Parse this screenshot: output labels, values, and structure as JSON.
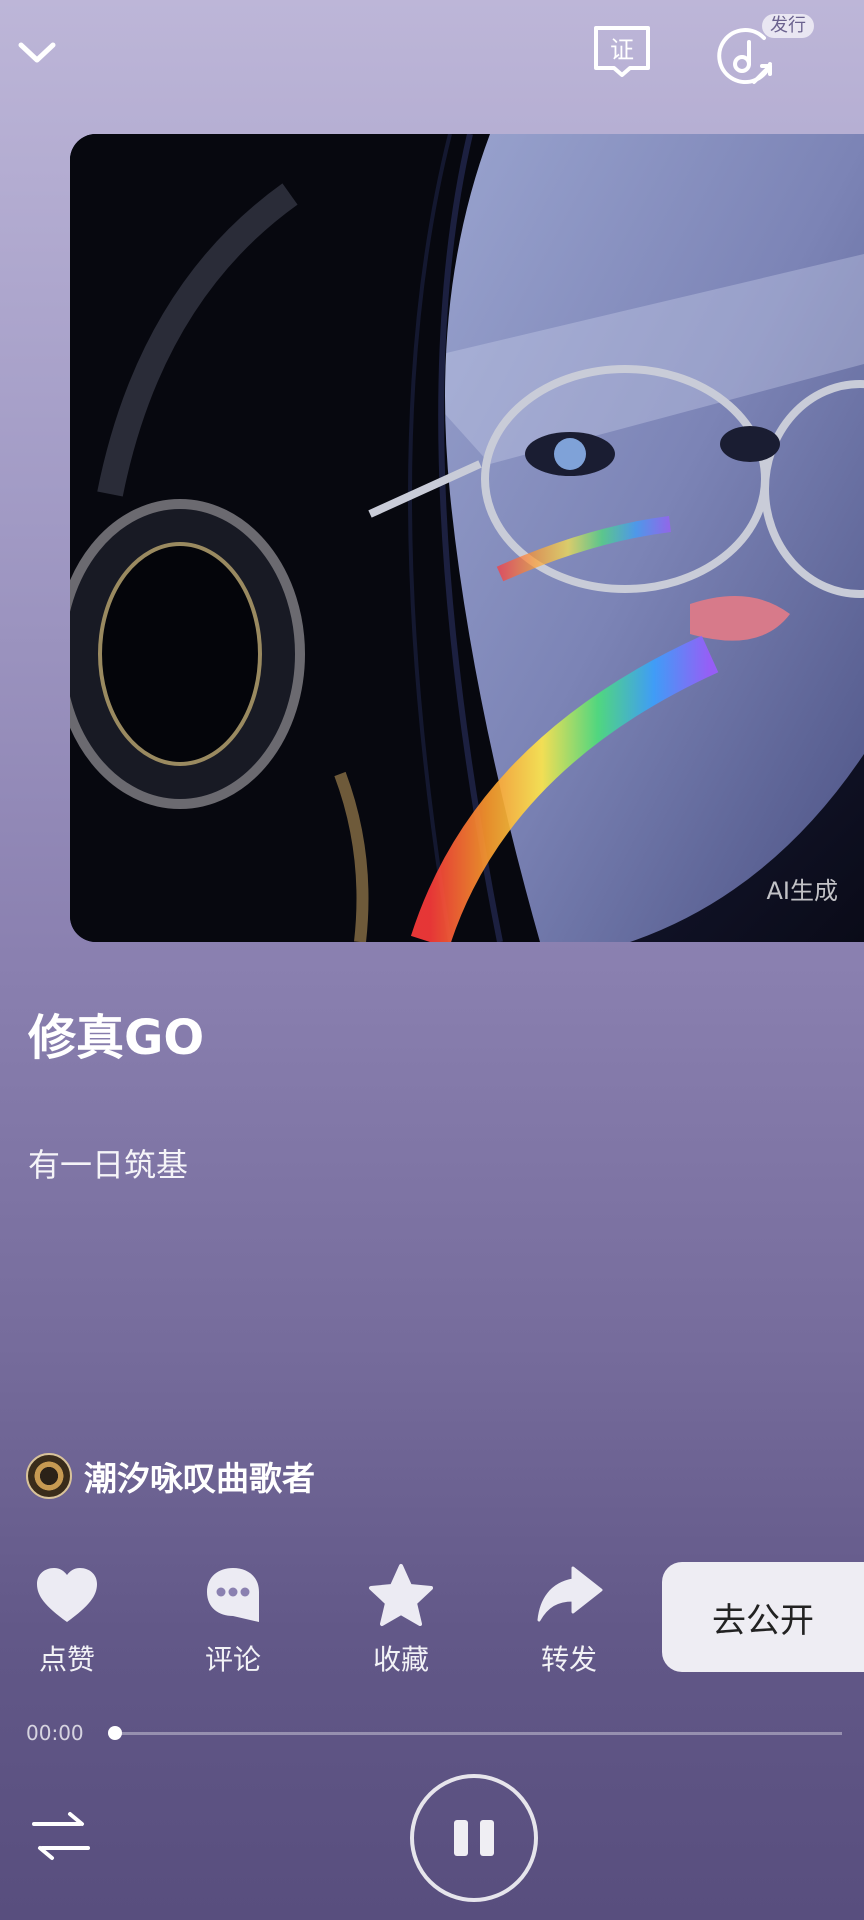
{
  "header": {
    "collapse_icon": "chevron-down-icon",
    "cert_icon": "certificate-icon",
    "cert_label": "证",
    "release_icon": "music-release-icon",
    "release_badge": "发行"
  },
  "cover": {
    "ai_label": "AI生成"
  },
  "song": {
    "title": "修真GO",
    "subtitle": "有一日筑基"
  },
  "singer": {
    "name": "潮汐咏叹曲歌者"
  },
  "actions": {
    "like": "点赞",
    "comment": "评论",
    "favorite": "收藏",
    "share": "转发",
    "publish": "去公开"
  },
  "player": {
    "elapsed": "00:00",
    "progress": 0
  },
  "colors": {
    "bg_top": "#bdb6d8",
    "bg_bottom": "#584e7e",
    "publish_bg": "#eeedf3"
  }
}
